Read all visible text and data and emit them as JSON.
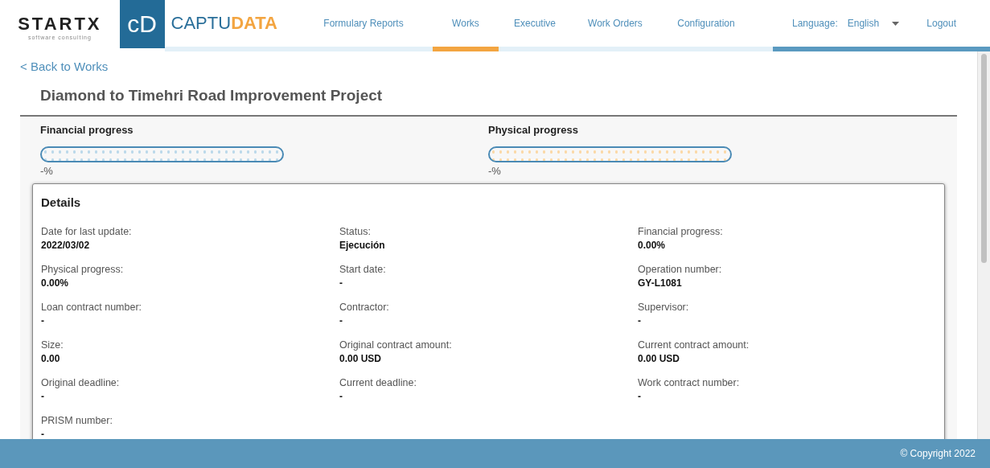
{
  "brand": {
    "company": "STARTX",
    "tagline": "software consulting",
    "logo_mark": "cD",
    "product_a": "CAPTU",
    "product_b": "DATA"
  },
  "nav": [
    {
      "label": "Formulary Reports",
      "selected": false
    },
    {
      "label": "Works",
      "selected": true
    },
    {
      "label": "Executive",
      "selected": false
    },
    {
      "label": "Work Orders",
      "selected": false
    },
    {
      "label": "Configuration",
      "selected": false
    }
  ],
  "language": {
    "label": "Language:",
    "value": "English"
  },
  "logout": "Logout",
  "back_link": "< Back to Works",
  "title": "Diamond to Timehri Road Improvement Project",
  "progress": [
    {
      "label": "Financial progress",
      "level": 0,
      "color": "#bcd9ea",
      "reading": "-%"
    },
    {
      "label": "Physical progress",
      "level": 0,
      "color": "#fbd9a8",
      "reading": "-%"
    }
  ],
  "details": {
    "title": "Details",
    "fields": [
      {
        "label": "Date for last update:",
        "value": "2022/03/02"
      },
      {
        "label": "Status:",
        "value": "Ejecución"
      },
      {
        "label": "Financial progress:",
        "value": "0.00%"
      },
      {
        "label": "Physical progress:",
        "value": "0.00%"
      },
      {
        "label": "Start date:",
        "value": "-"
      },
      {
        "label": "Operation number:",
        "value": "GY-L1081"
      },
      {
        "label": "Loan contract number:",
        "value": "-"
      },
      {
        "label": "Contractor:",
        "value": "-"
      },
      {
        "label": "Supervisor:",
        "value": "-"
      },
      {
        "label": "Size:",
        "value": "0.00"
      },
      {
        "label": "Original contract amount:",
        "value": "0.00 USD"
      },
      {
        "label": "Current contract amount:",
        "value": "0.00 USD"
      },
      {
        "label": "Original deadline:",
        "value": "-"
      },
      {
        "label": "Current deadline:",
        "value": "-"
      },
      {
        "label": "Work contract number:",
        "value": "-"
      },
      {
        "label": "PRISM number:",
        "value": "-"
      }
    ]
  },
  "footer": "© Copyright 2022"
}
